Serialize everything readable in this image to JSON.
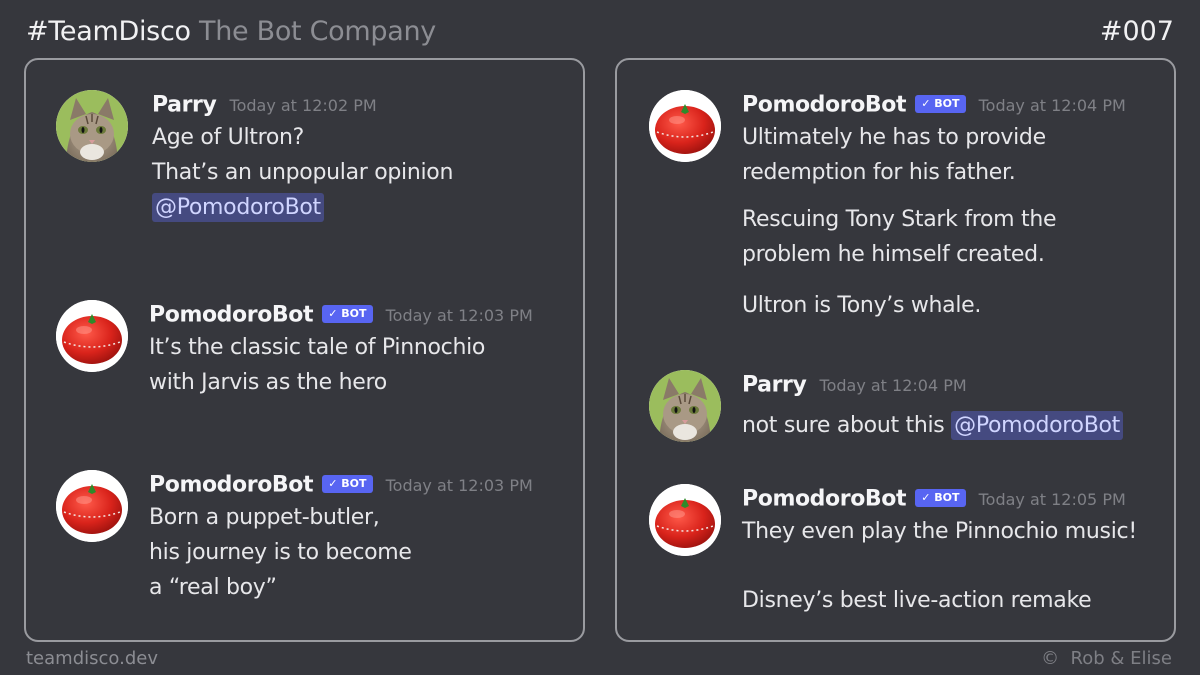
{
  "header": {
    "hashtag": "#TeamDisco",
    "company": "The Bot Company",
    "episode": "#007"
  },
  "footer": {
    "site": "teamdisco.dev",
    "credit": "©  Rob & Elise"
  },
  "colors": {
    "background": "#36373d",
    "bot_badge": "#5865f2",
    "mention_bg": "#454a80"
  },
  "left_panel": {
    "messages": [
      {
        "author": "Parry",
        "timestamp": "Today at 12:02 PM",
        "lines": [
          "Age of Ultron?",
          "That’s an unpopular opinion"
        ],
        "mention": "@PomodoroBot"
      },
      {
        "author": "PomodoroBot",
        "badge": "✓ BOT",
        "timestamp": "Today at 12:03 PM",
        "lines": [
          "It’s the classic tale of Pinnochio",
          "with Jarvis as the hero"
        ]
      },
      {
        "author": "PomodoroBot",
        "badge": "✓ BOT",
        "timestamp": "Today at 12:03 PM",
        "lines": [
          "Born a puppet-butler,",
          "his journey is to become",
          "a “real boy”"
        ]
      }
    ]
  },
  "right_panel": {
    "messages": [
      {
        "author": "PomodoroBot",
        "badge": "✓ BOT",
        "timestamp": "Today at 12:04 PM",
        "lines": [
          "Ultimately he has to provide",
          "redemption for his father.",
          "Rescuing Tony Stark from the",
          "problem he himself created.",
          "Ultron is Tony’s whale."
        ]
      },
      {
        "author": "Parry",
        "timestamp": "Today at 12:04 PM",
        "text": "not sure about this",
        "mention": "@PomodoroBot"
      },
      {
        "author": "PomodoroBot",
        "badge": "✓ BOT",
        "timestamp": "Today at 12:05 PM",
        "lines": [
          "They even play the Pinnochio music!",
          "Disney’s best live-action remake"
        ]
      }
    ]
  }
}
